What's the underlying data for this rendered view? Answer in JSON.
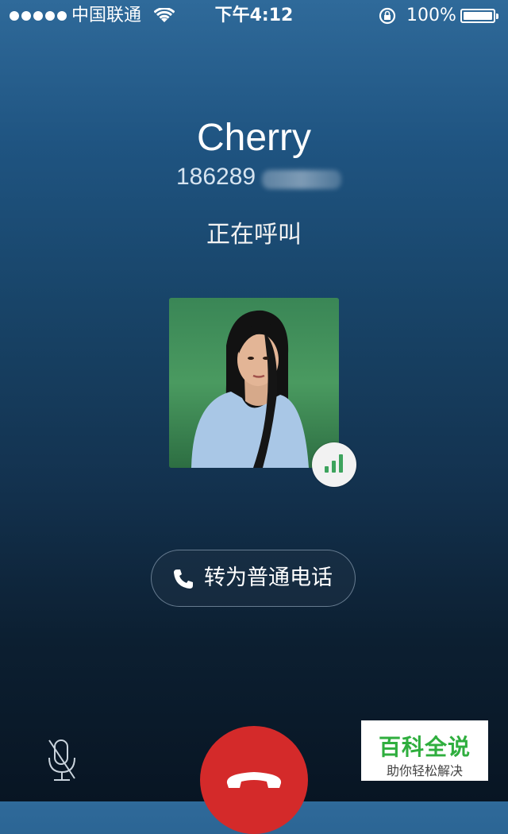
{
  "status_bar": {
    "carrier": "中国联通",
    "time": "下午4:12",
    "battery": "100%",
    "battery_level": 1.0,
    "icons": [
      "signal-dots-icon",
      "wifi-icon",
      "rotation-lock-icon",
      "battery-icon"
    ]
  },
  "caller": {
    "name": "Cherry",
    "number": "186289",
    "status": "正在呼叫"
  },
  "avatar": {
    "badge_icon": "signal-strength-icon",
    "badge_color": "#3da35d"
  },
  "switch_button": {
    "label": "转为普通电话",
    "icon": "phone-icon"
  },
  "controls": {
    "mute_icon": "microphone-muted-icon",
    "hangup_icon": "hangup-icon",
    "hangup_color": "#d42a2a"
  },
  "watermark": {
    "title": "百科全说",
    "subtitle": "助你轻松解决",
    "color": "#2fae3e"
  }
}
